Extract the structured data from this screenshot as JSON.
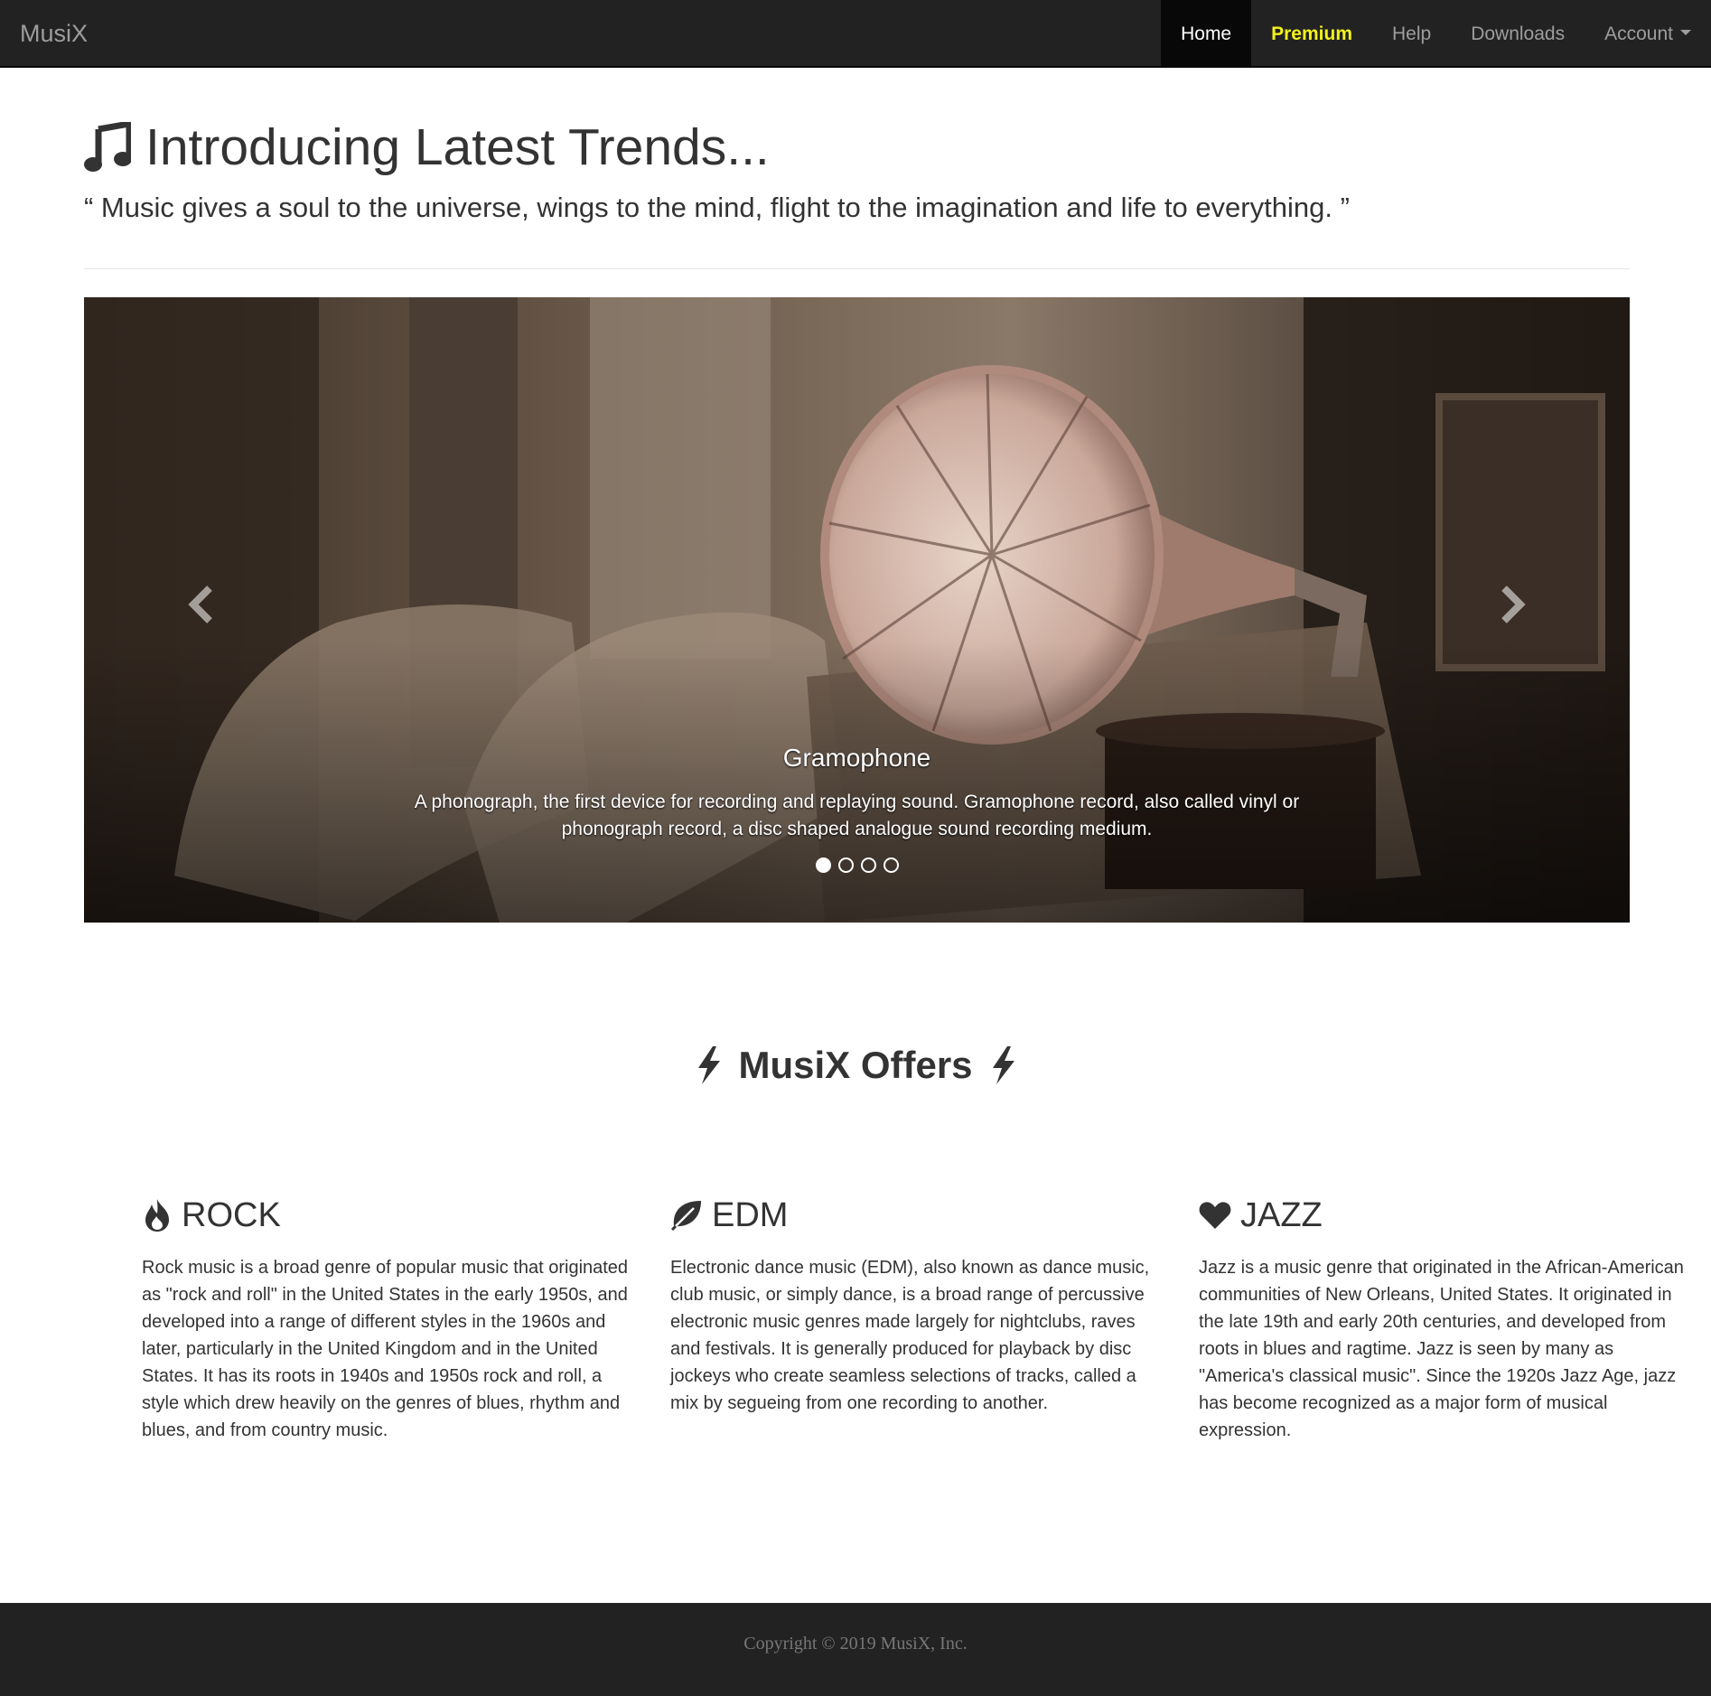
{
  "navbar": {
    "brand": "MusiX",
    "items": [
      {
        "label": "Home",
        "active": true
      },
      {
        "label": "Premium"
      },
      {
        "label": "Help"
      },
      {
        "label": "Downloads"
      },
      {
        "label": "Account",
        "dropdown": true
      }
    ]
  },
  "header": {
    "title": "Introducing Latest Trends...",
    "title_icon": "music-note-icon",
    "quote": "“ Music gives a soul to the universe, wings to the mind, flight to the imagination and life to everything. ”"
  },
  "carousel": {
    "caption_title": "Gramophone",
    "caption_text": "A phonograph, the first device for recording and replaying sound. Gramophone record, also called vinyl or phonograph record, a disc shaped analogue sound recording medium.",
    "active_slide": 1,
    "slide_count": 4
  },
  "offers": {
    "title": "MusiX Offers",
    "title_icon": "lightning-bolt-icon",
    "genres": [
      {
        "name": "ROCK",
        "icon": "fire-icon",
        "text": "Rock music is a broad genre of popular music that originated as \"rock and roll\" in the United States in the early 1950s, and developed into a range of different styles in the 1960s and later, particularly in the United Kingdom and in the United States. It has its roots in 1940s and 1950s rock and roll, a style which drew heavily on the genres of blues, rhythm and blues, and from country music."
      },
      {
        "name": "EDM",
        "icon": "leaf-icon",
        "text": "Electronic dance music (EDM), also known as dance music, club music, or simply dance, is a broad range of percussive electronic music genres made largely for nightclubs, raves and festivals. It is generally produced for playback by disc jockeys who create seamless selections of tracks, called a mix by segueing from one recording to another."
      },
      {
        "name": "JAZZ",
        "icon": "heart-icon",
        "text": "Jazz is a music genre that originated in the African-American communities of New Orleans, United States. It originated in the late 19th and early 20th centuries, and developed from roots in blues and ragtime. Jazz is seen by many as \"America's classical music\". Since the 1920s Jazz Age, jazz has become recognized as a major form of musical expression."
      }
    ]
  },
  "footer": {
    "copyright": "Copyright © 2019 MusiX, Inc."
  },
  "colors": {
    "navbar_bg": "#222222",
    "nav_active_bg": "#080808",
    "premium": "#f2f21a",
    "text": "#333333",
    "footer_text": "#777777"
  }
}
